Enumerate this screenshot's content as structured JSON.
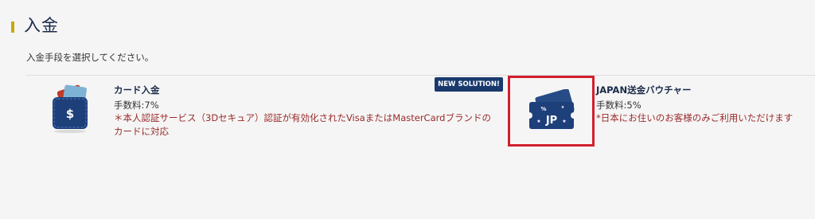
{
  "heading": {
    "title": "入金"
  },
  "instruction": "入金手段を選択してください。",
  "options": [
    {
      "title": "カード入金",
      "fee": "手数料:7%",
      "note": "＊本人認証サービス（3Dセキュア）認証が有効化されたVisaまたはMasterCardブランドのカードに対応",
      "icon": "wallet-icon",
      "icon_symbol": "$"
    },
    {
      "badge": "NEW SOLUTION!",
      "title": "JAPAN送金バウチャー",
      "fee": "手数料:5%",
      "note": "*日本にお住いのお客様のみご利用いただけます",
      "icon": "voucher-ticket-icon",
      "icon_symbol": "JP",
      "highlight_color": "#d31f2d"
    }
  ],
  "colors": {
    "heading_accent": "#c8a800",
    "title": "#1a2b4a",
    "note": "#9a2a2a",
    "badge_bg": "#1a3a6e",
    "icon_blue": "#1d3f7a"
  }
}
